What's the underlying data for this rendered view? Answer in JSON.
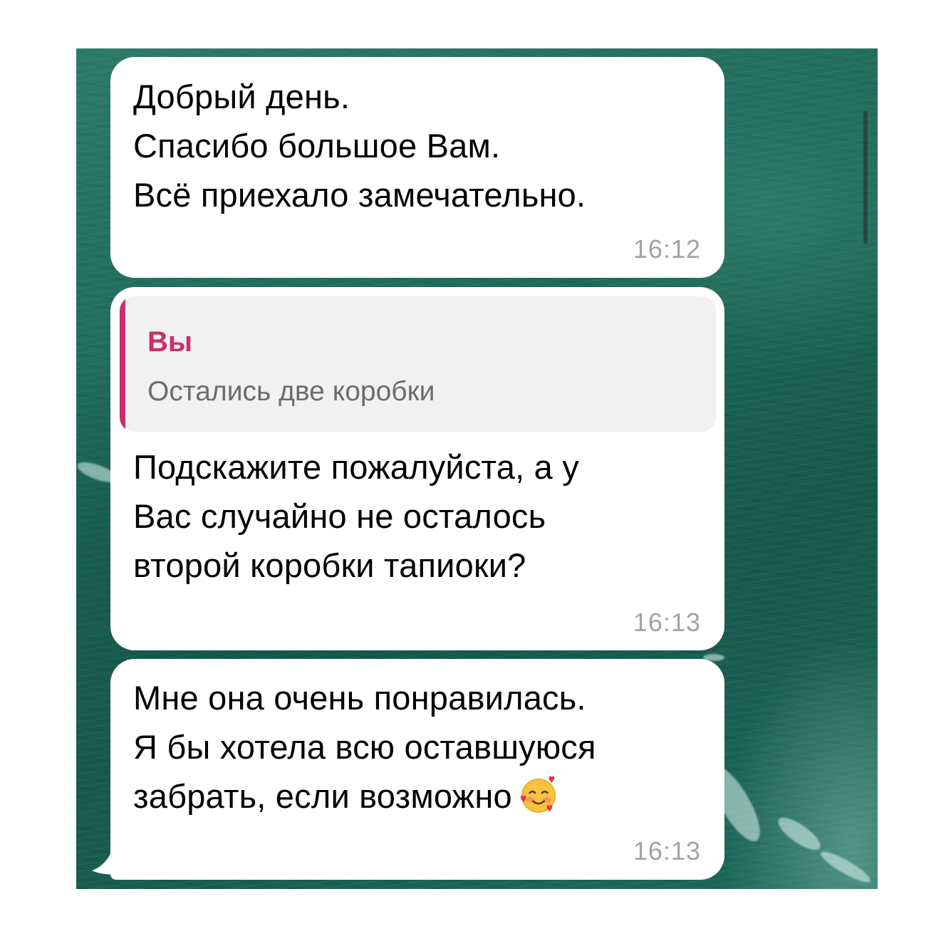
{
  "messages": [
    {
      "text": "Добрый день.\nСпасибо большое Вам.\nВсё приехало замечательно.",
      "time": "16:12"
    },
    {
      "reply": {
        "author": "Вы",
        "snippet": "Остались две коробки"
      },
      "text": "Подскажите пожалуйста, а у\nВас случайно не осталось\nвторой коробки тапиоки?",
      "time": "16:13"
    },
    {
      "text_lines": [
        "Мне она очень понравилась.",
        "Я бы хотела всю оставшуюся",
        "забрать, если возможно"
      ],
      "emoji": "smiling-face-with-hearts",
      "time": "16:13"
    }
  ],
  "colors": {
    "reply_accent": "#c92f6b",
    "bubble": "#ffffff",
    "timestamp": "#a2a2a7"
  }
}
